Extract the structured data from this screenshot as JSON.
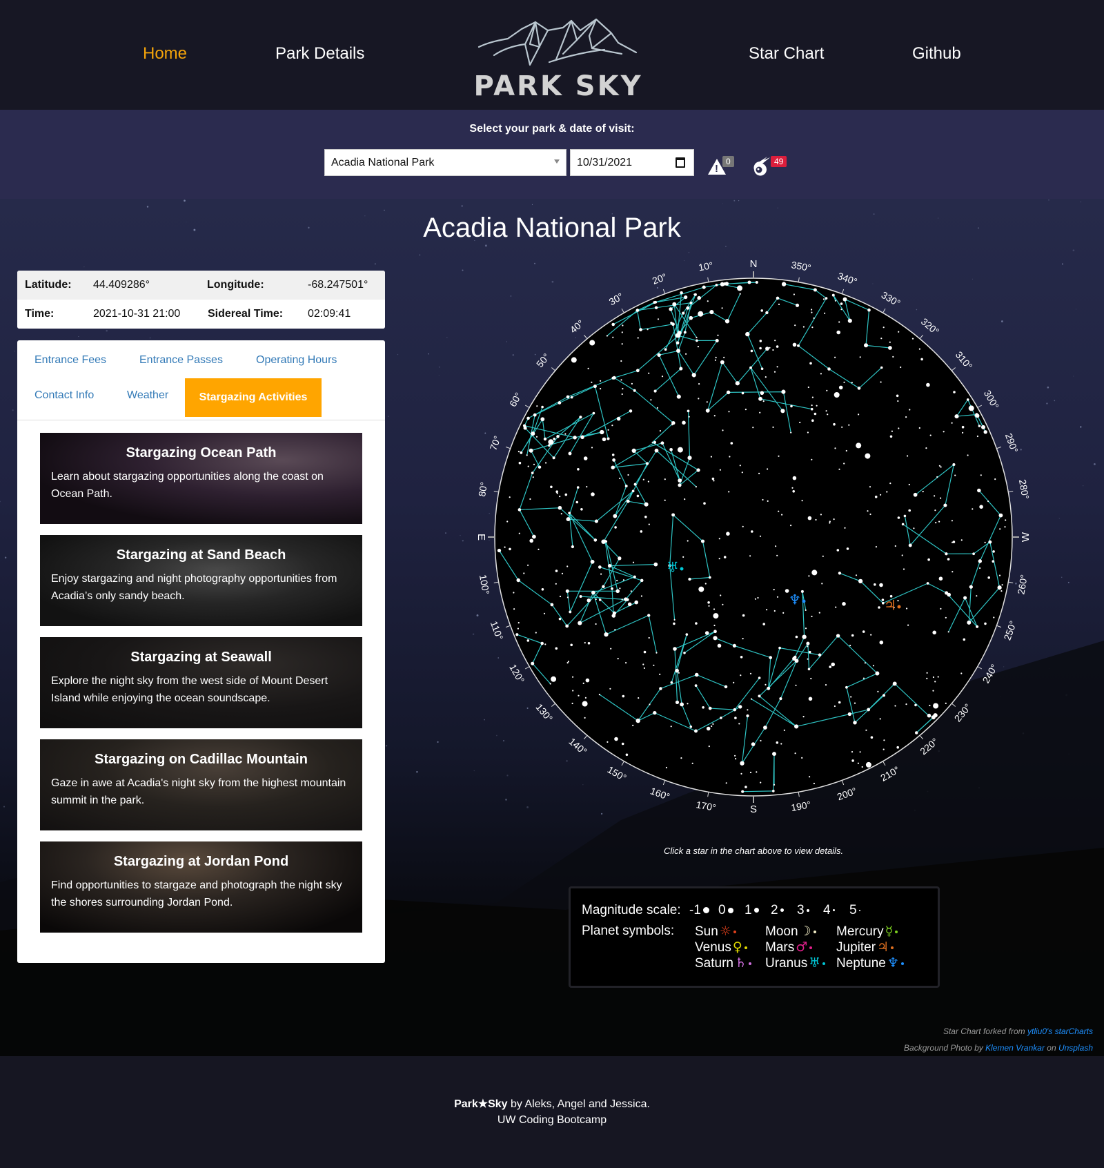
{
  "header": {
    "nav": [
      {
        "label": "Home",
        "active": true
      },
      {
        "label": "Park Details",
        "active": false
      },
      {
        "label": "Star Chart",
        "active": false
      },
      {
        "label": "Github",
        "active": false
      }
    ],
    "logo_text": "PARK SKY",
    "accent_color": "#f5a40a"
  },
  "selector": {
    "label": "Select your park & date of visit:",
    "park_value": "Acadia National Park",
    "date_value": "10/31/2021",
    "alerts_count": "0",
    "events_count": "49"
  },
  "park": {
    "title": "Acadia National Park",
    "info": {
      "latitude_label": "Latitude:",
      "latitude": "44.409286°",
      "longitude_label": "Longitude:",
      "longitude": "-68.247501°",
      "time_label": "Time:",
      "time": "2021-10-31 21:00",
      "sidereal_label": "Sidereal Time:",
      "sidereal": "02:09:41"
    }
  },
  "tabs": [
    {
      "label": "Entrance Fees",
      "active": false
    },
    {
      "label": "Entrance Passes",
      "active": false
    },
    {
      "label": "Operating Hours",
      "active": false
    },
    {
      "label": "Contact Info",
      "active": false
    },
    {
      "label": "Weather",
      "active": false
    },
    {
      "label": "Stargazing Activities",
      "active": true
    }
  ],
  "activities": [
    {
      "title": "Stargazing Ocean Path",
      "description": "Learn about stargazing opportunities along the coast on Ocean Path."
    },
    {
      "title": "Stargazing at Sand Beach",
      "description": "Enjoy stargazing and night photography opportunities from Acadia’s only sandy beach."
    },
    {
      "title": "Stargazing at Seawall",
      "description": "Explore the night sky from the west side of Mount Desert Island while enjoying the ocean soundscape."
    },
    {
      "title": "Stargazing on Cadillac Mountain",
      "description": "Gaze in awe at Acadia's night sky from the highest mountain summit in the park."
    },
    {
      "title": "Stargazing at Jordan Pond",
      "description": "Find opportunities to stargaze and photograph the night sky the shores surrounding Jordan Pond."
    }
  ],
  "star_chart": {
    "compass": {
      "north": "N",
      "east": "E",
      "south": "S",
      "west": "W"
    },
    "azimuth_labels": [
      "10°",
      "20°",
      "30°",
      "40°",
      "50°",
      "60°",
      "70°",
      "80°",
      "100°",
      "110°",
      "120°",
      "130°",
      "140°",
      "150°",
      "160°",
      "170°",
      "190°",
      "200°",
      "210°",
      "220°",
      "230°",
      "240°",
      "250°",
      "260°",
      "280°",
      "290°",
      "300°",
      "310°",
      "320°",
      "330°",
      "340°",
      "350°"
    ],
    "constellation_color": "#2ec4c4",
    "planets_visible": [
      {
        "name": "Uranus",
        "symbol": "♅",
        "color": "#00c8d7"
      },
      {
        "name": "Neptune",
        "symbol": "♆",
        "color": "#1e90ff"
      },
      {
        "name": "Jupiter",
        "symbol": "♃",
        "color": "#e07020"
      }
    ],
    "note": "Click a star in the chart above to view details."
  },
  "legend": {
    "magnitude_label": "Magnitude scale:",
    "magnitudes": [
      "-1",
      "0",
      "1",
      "2",
      "3",
      "4",
      "5"
    ],
    "planet_label": "Planet symbols:",
    "planets": [
      {
        "name": "Sun",
        "symbol": "☼",
        "color": "#e0401c"
      },
      {
        "name": "Moon",
        "symbol": "☽",
        "color": "#f5f0c8"
      },
      {
        "name": "Mercury",
        "symbol": "☿",
        "color": "#7ccf1f"
      },
      {
        "name": "Venus",
        "symbol": "♀",
        "color": "#e0d800"
      },
      {
        "name": "Mars",
        "symbol": "♂",
        "color": "#e0208c"
      },
      {
        "name": "Jupiter",
        "symbol": "♃",
        "color": "#e07020"
      },
      {
        "name": "Saturn",
        "symbol": "♄",
        "color": "#d070e0"
      },
      {
        "name": "Uranus",
        "symbol": "♅",
        "color": "#00c8d7"
      },
      {
        "name": "Neptune",
        "symbol": "♆",
        "color": "#1e90ff"
      }
    ]
  },
  "credits": {
    "line1_prefix": "Star Chart forked from ",
    "line1_link": "ytliu0's starCharts",
    "line2_prefix": "Background Photo by ",
    "line2_link1": "Klemen Vrankar",
    "line2_mid": " on ",
    "line2_link2": "Unsplash"
  },
  "footer": {
    "brand": "Park★Sky",
    "authors": " by Aleks, Angel and Jessica.",
    "line2": "UW Coding Bootcamp"
  }
}
